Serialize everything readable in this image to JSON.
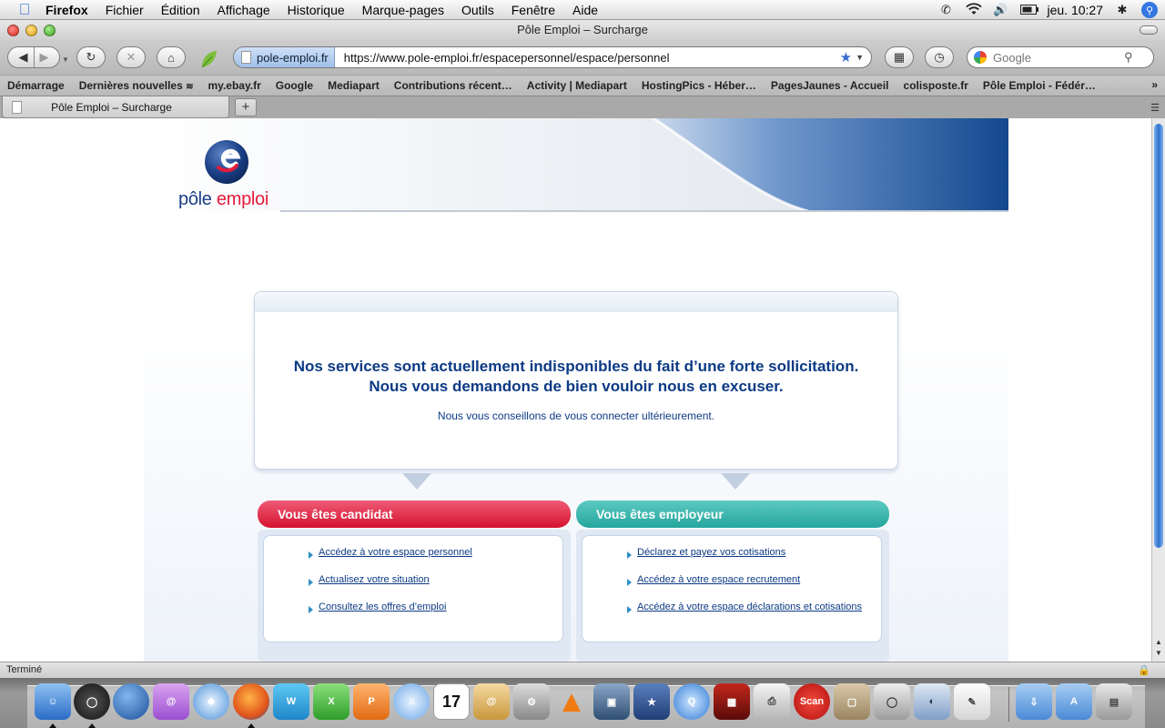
{
  "menubar": {
    "app_name": "Firefox",
    "items": [
      "Fichier",
      "Édition",
      "Affichage",
      "Historique",
      "Marque-pages",
      "Outils",
      "Fenêtre",
      "Aide"
    ],
    "clock": "jeu. 10:27"
  },
  "window": {
    "title": "Pôle Emploi – Surcharge"
  },
  "toolbar": {
    "site_identity": "pole-emploi.fr",
    "url": "https://www.pole-emploi.fr/espacepersonnel/espace/personnel",
    "search_placeholder": "Google"
  },
  "bookmarks": {
    "items": [
      "Démarrage",
      "Dernières nouvelles",
      "my.ebay.fr",
      "Google",
      "Mediapart",
      "Contributions récent…",
      "Activity | Mediapart",
      "HostingPics - Héber…",
      "PagesJaunes - Accueil",
      "colisposte.fr",
      "Pôle Emploi - Fédér…"
    ],
    "overflow": "»"
  },
  "tabs": {
    "active_label": "Pôle Emploi – Surcharge",
    "new_tab": "+"
  },
  "page": {
    "logo_text_1": "pôle",
    "logo_text_2": "emploi",
    "message_line1": "Nos services sont actuellement indisponibles du fait d’une forte sollicitation.",
    "message_line2": "Nous vous demandons de bien vouloir nous en excuser.",
    "message_sub": "Nous vous conseillons de vous connecter ultérieurement.",
    "candidat": {
      "title": "Vous êtes candidat",
      "links": [
        "Accédez à votre espace personnel",
        "Actualisez votre situation",
        "Consultez les offres d’emploi"
      ]
    },
    "employeur": {
      "title": "Vous êtes employeur",
      "links": [
        "Déclarez et payez vos cotisations",
        "Accédez à votre espace recrutement",
        "Accédez à votre espace déclarations et cotisations"
      ]
    },
    "colors": {
      "navy": "#0c3a84",
      "candidat_red": "#d4122f",
      "employeur_teal": "#25a59d"
    }
  },
  "statusbar": {
    "text": "Terminé"
  },
  "dock": {
    "icons": [
      "finder-icon",
      "dashboard-icon",
      "google-earth-icon",
      "ichat-icon",
      "safari-icon",
      "firefox-icon",
      "word-icon",
      "excel-icon",
      "powerpoint-icon",
      "itunes-icon",
      "ical-icon",
      "address-book-icon",
      "preferences-icon",
      "vlc-icon",
      "iphoto-icon",
      "imovie-icon",
      "quicktime-icon",
      "photobooth-icon",
      "printer-icon",
      "scan-icon",
      "installer-icon",
      "dvd-player-icon",
      "image-capture-icon",
      "textedit-icon",
      "downloads-folder-icon",
      "applications-folder-icon",
      "trash-icon"
    ],
    "scan_label": "Scan",
    "ical_day": "17"
  }
}
